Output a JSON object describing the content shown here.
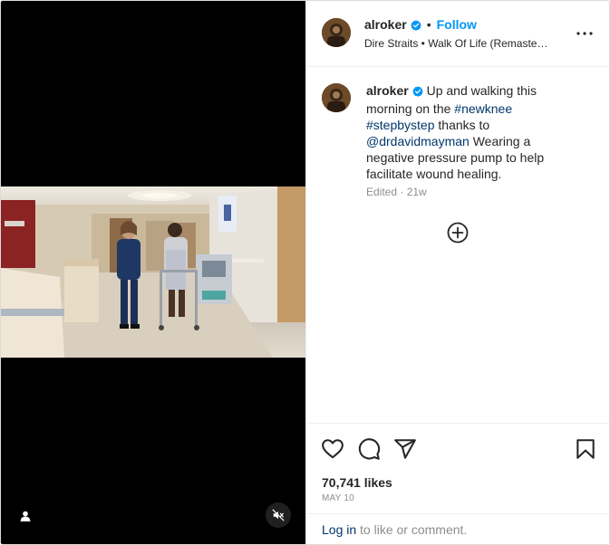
{
  "post": {
    "username": "alroker",
    "verified": true,
    "follow_label": "Follow",
    "separator": "•",
    "audio": "Dire Straits • Walk Of Life (Remaste…",
    "caption": {
      "username": "alroker",
      "text_1": " Up and walking this morning on the ",
      "hashtag_1": "#newknee",
      "space": " ",
      "hashtag_2": "#stepbystep",
      "text_2": " thanks to ",
      "mention": "@drdavidmayman",
      "text_3": " Wearing a negative pressure pump to help facilitate wound healing."
    },
    "edited_meta": "Edited · 21w",
    "likes": "70,741 likes",
    "date": "MAY 10"
  },
  "login_bar": {
    "link": "Log in",
    "rest": " to like or comment."
  },
  "icons": {
    "more": "more-horizontal-icon",
    "verified": "verified-badge-icon",
    "plus": "plus-circle-icon",
    "like": "heart-icon",
    "comment": "comment-icon",
    "share": "share-paper-plane-icon",
    "save": "bookmark-icon",
    "user_tag": "user-tag-icon",
    "mute": "speaker-muted-icon"
  },
  "colors": {
    "accent_blue": "#0095f6",
    "link": "#00376b",
    "verified": "#0095f6",
    "muted_text": "#8e8e8e"
  }
}
